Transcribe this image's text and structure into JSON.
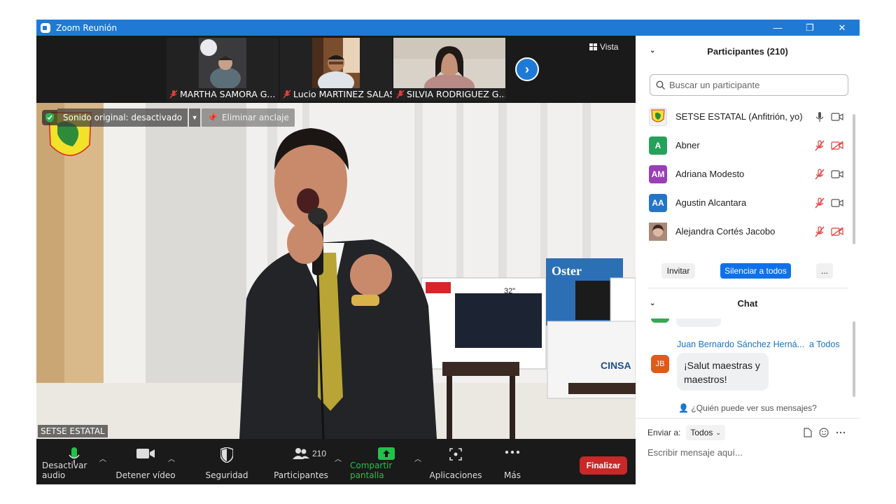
{
  "window": {
    "title": "Zoom Reunión",
    "minimize": "—",
    "restore": "❐",
    "close": "✕"
  },
  "filmstrip": {
    "thumbnails": [
      {
        "name": "MARTHA SAMORA G..."
      },
      {
        "name": "Lucio MARTINEZ SALAS"
      },
      {
        "name": "SILVIA RODRIGUEZ G..."
      }
    ],
    "view_label": "Vista"
  },
  "main_video": {
    "speaker_name": "SETSE ESTATAL",
    "original_sound": "Sonido original: desactivado",
    "unpin": "Eliminar anclaje"
  },
  "toolbar": {
    "audio": "Desactivar audio",
    "video": "Detener vídeo",
    "security": "Seguridad",
    "participants": "Participantes",
    "participants_count": "210",
    "share": "Compartir pantalla",
    "apps": "Aplicaciones",
    "more": "Más",
    "end": "Finalizar"
  },
  "participants_panel": {
    "title": "Participantes (210)",
    "search_placeholder": "Buscar un participante",
    "participants": [
      {
        "name": "SETSE ESTATAL (Anfitrión, yo)",
        "initials": "",
        "color": "#f2f2f2",
        "mic": "on",
        "video": "on"
      },
      {
        "name": "Abner",
        "initials": "A",
        "color": "#26a15b",
        "mic": "muted",
        "video": "off"
      },
      {
        "name": "Adriana Modesto",
        "initials": "AM",
        "color": "#9a3fb6",
        "mic": "muted",
        "video": "on"
      },
      {
        "name": "Agustin Alcantara",
        "initials": "AA",
        "color": "#2475c9",
        "mic": "muted",
        "video": "on"
      },
      {
        "name": "Alejandra Cortés Jacobo",
        "initials": "",
        "color": "#8a6a5a",
        "mic": "muted",
        "video": "off"
      }
    ],
    "invite": "Invitar",
    "mute_all": "Silenciar a todos",
    "more": "..."
  },
  "chat_panel": {
    "title": "Chat",
    "message": {
      "sender": "Juan Bernardo Sánchez Herná...",
      "to": "a Todos",
      "initials": "JB",
      "text_line1": "¡Salut maestras y",
      "text_line2": "maestros!"
    },
    "who_can_see": "¿Quién puede ver sus mensajes?",
    "send_to_label": "Enviar a:",
    "send_to_value": "Todos",
    "input_placeholder": "Escribir mensaje aquí..."
  }
}
